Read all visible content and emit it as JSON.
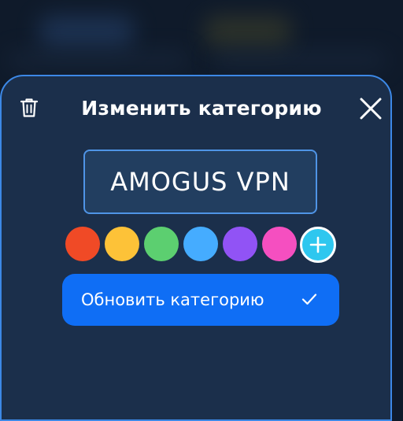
{
  "dialog": {
    "title": "Изменить категорию",
    "name_value": "AMOGUS VPN",
    "submit_label": "Обновить категорию"
  },
  "icons": {
    "delete": "trash-icon",
    "close": "close-icon",
    "add": "plus-icon",
    "confirm": "check-icon"
  },
  "colors": {
    "sheet_background": "#1b2f4b",
    "accent": "#0f6ef5",
    "border": "#3c88e6",
    "swatches": [
      "#f04a26",
      "#fdc238",
      "#5ccf70",
      "#45acff",
      "#9153f5",
      "#f54fc0"
    ],
    "add_swatch": "#2ec7ef"
  }
}
